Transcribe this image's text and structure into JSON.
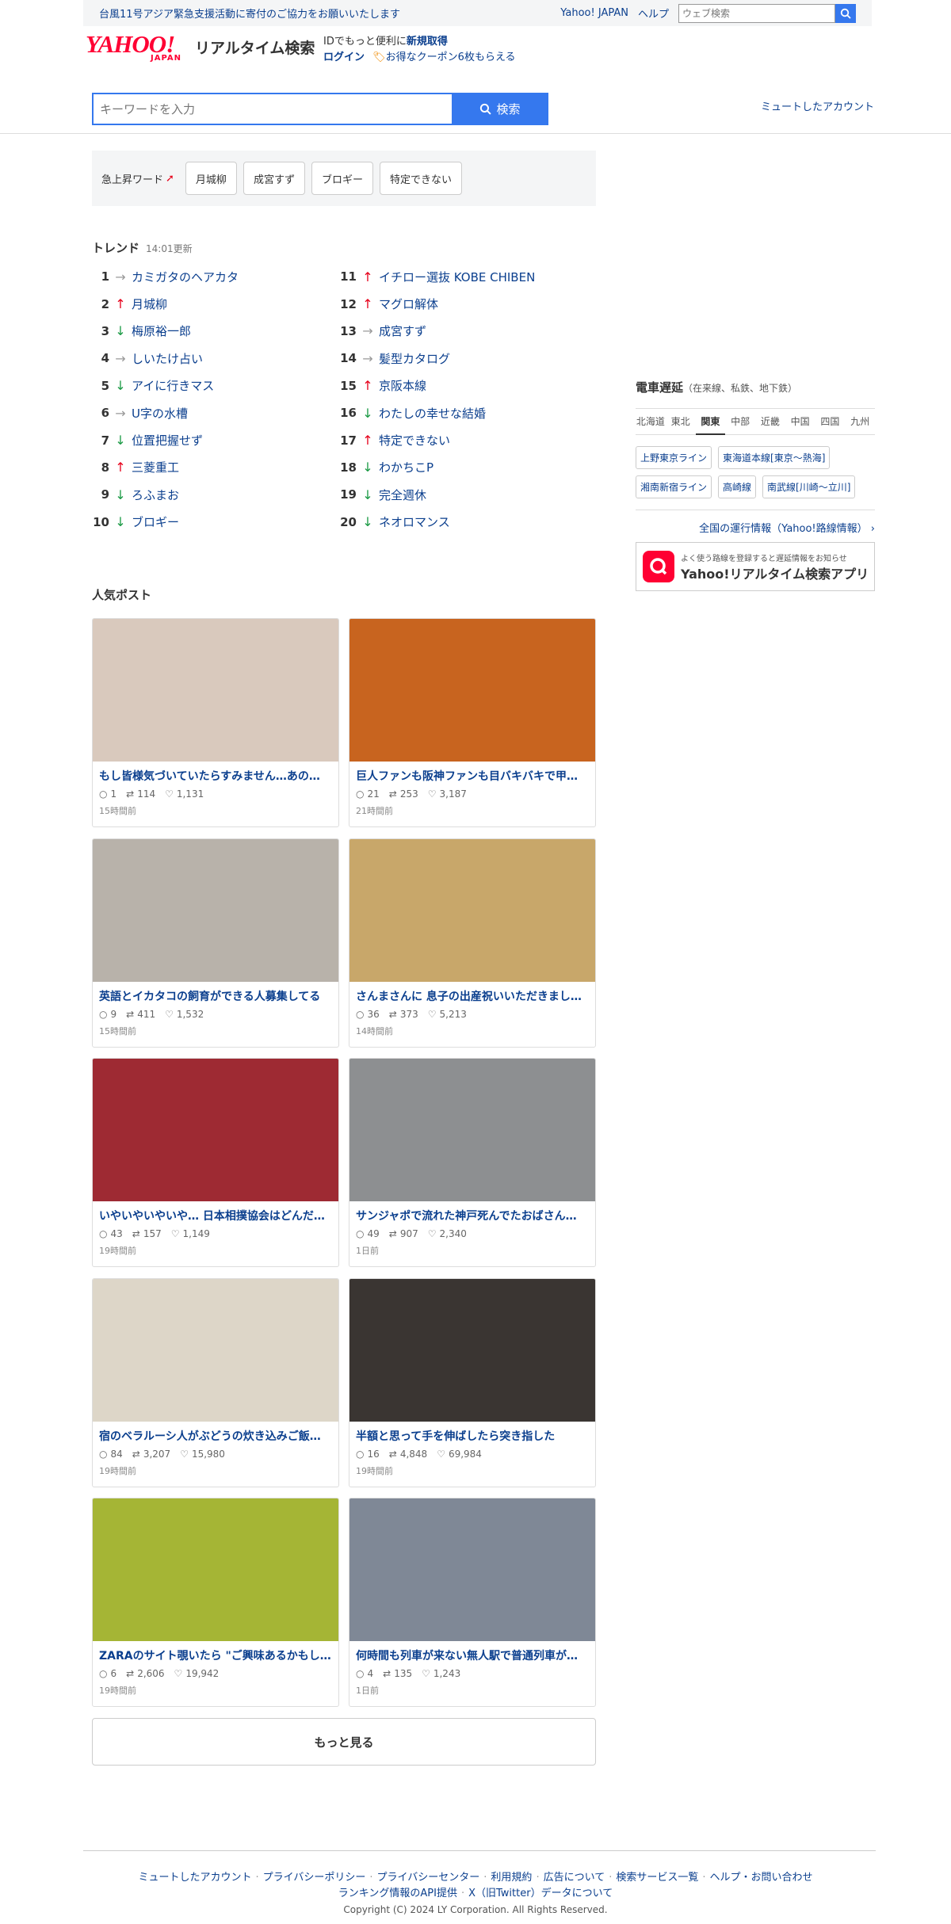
{
  "topbar": {
    "notice": "台風11号アジア緊急支援活動に寄付のご協力をお願いいたします",
    "yahoo_japan": "Yahoo! JAPAN",
    "help": "ヘルプ",
    "web_search_placeholder": "ウェブ検索"
  },
  "header": {
    "logo_yahoo": "YAHOO!",
    "logo_japan": "JAPAN",
    "logo_service": "リアルタイム検索",
    "id_text": "IDでもっと便利に",
    "id_signup": "新規取得",
    "login": "ログイン",
    "coupon": "お得なクーポン6枚もらえる"
  },
  "search": {
    "placeholder": "キーワードを入力",
    "button": "検索",
    "muted_accounts": "ミュートしたアカウント"
  },
  "rising": {
    "label": "急上昇ワード",
    "chips": [
      "月城柳",
      "成宮すず",
      "ブロギー",
      "特定できない"
    ]
  },
  "trend": {
    "title": "トレンド",
    "updated": "14:01更新",
    "items": [
      {
        "rank": "1",
        "dir": "flat",
        "word": "カミガタのヘアカタ"
      },
      {
        "rank": "2",
        "dir": "up",
        "word": "月城柳"
      },
      {
        "rank": "3",
        "dir": "down",
        "word": "梅原裕一郎"
      },
      {
        "rank": "4",
        "dir": "flat",
        "word": "しいたけ占い"
      },
      {
        "rank": "5",
        "dir": "down",
        "word": "アイに行きマス"
      },
      {
        "rank": "6",
        "dir": "flat",
        "word": "U字の水槽"
      },
      {
        "rank": "7",
        "dir": "down",
        "word": "位置把握せず"
      },
      {
        "rank": "8",
        "dir": "up",
        "word": "三菱重工"
      },
      {
        "rank": "9",
        "dir": "down",
        "word": "ろふまお"
      },
      {
        "rank": "10",
        "dir": "down",
        "word": "ブロギー"
      },
      {
        "rank": "11",
        "dir": "up",
        "word": "イチロー選抜 KOBE CHIBEN"
      },
      {
        "rank": "12",
        "dir": "up",
        "word": "マグロ解体"
      },
      {
        "rank": "13",
        "dir": "flat",
        "word": "成宮すず"
      },
      {
        "rank": "14",
        "dir": "flat",
        "word": "髪型カタログ"
      },
      {
        "rank": "15",
        "dir": "up",
        "word": "京阪本線"
      },
      {
        "rank": "16",
        "dir": "down",
        "word": "わたしの幸せな結婚"
      },
      {
        "rank": "17",
        "dir": "up",
        "word": "特定できない"
      },
      {
        "rank": "18",
        "dir": "down",
        "word": "わかちこP"
      },
      {
        "rank": "19",
        "dir": "down",
        "word": "完全週休"
      },
      {
        "rank": "20",
        "dir": "down",
        "word": "ネオロマンス"
      }
    ]
  },
  "posts": {
    "title": "人気ポスト",
    "items": [
      {
        "title": "もし皆様気づいていたらすみません…あの…",
        "replies": "1",
        "reposts": "114",
        "likes": "1,131",
        "time": "15時間前",
        "color": "#d9c9bd"
      },
      {
        "title": "巨人ファンも阪神ファンも目バキバキで甲…",
        "replies": "21",
        "reposts": "253",
        "likes": "3,187",
        "time": "21時間前",
        "color": "#c8641f"
      },
      {
        "title": "英語とイカタコの飼育ができる人募集してる",
        "replies": "9",
        "reposts": "411",
        "likes": "1,532",
        "time": "15時間前",
        "color": "#b8b2aa"
      },
      {
        "title": "さんまさんに 息子の出産祝いいただきまし…",
        "replies": "36",
        "reposts": "373",
        "likes": "5,213",
        "time": "14時間前",
        "color": "#c8a76a"
      },
      {
        "title": "いやいやいやいや… 日本相撲協会はどんだ…",
        "replies": "43",
        "reposts": "157",
        "likes": "1,149",
        "time": "19時間前",
        "color": "#9e2a33"
      },
      {
        "title": "サンジャポで流れた神戸死んでたおばさん…",
        "replies": "49",
        "reposts": "907",
        "likes": "2,340",
        "time": "1日前",
        "color": "#8d8f91"
      },
      {
        "title": "宿のベラルーシ人がぶどうの炊き込みご飯…",
        "replies": "84",
        "reposts": "3,207",
        "likes": "15,980",
        "time": "19時間前",
        "color": "#ddd6c8"
      },
      {
        "title": "半額と思って手を伸ばしたら突き指した",
        "replies": "16",
        "reposts": "4,848",
        "likes": "69,984",
        "time": "19時間前",
        "color": "#3a3532"
      },
      {
        "title": "ZARAのサイト覗いたら \"ご興味あるかもし…",
        "replies": "6",
        "reposts": "2,606",
        "likes": "19,942",
        "time": "19時間前",
        "color": "#a5b535"
      },
      {
        "title": "何時間も列車が来ない無人駅で普通列車が…",
        "replies": "4",
        "reposts": "135",
        "likes": "1,243",
        "time": "1日前",
        "color": "#7f8896"
      }
    ],
    "more": "もっと見る"
  },
  "train": {
    "title": "電車遅延",
    "subtitle": "（在来線、私鉄、地下鉄）",
    "regions": [
      "北海道",
      "東北",
      "関東",
      "中部",
      "近畿",
      "中国",
      "四国",
      "九州"
    ],
    "lines": [
      "上野東京ライン",
      "東海道本線[東京～熱海]",
      "湘南新宿ライン",
      "高崎線",
      "南武線[川崎～立川]"
    ],
    "all_info": "全国の運行情報（Yahoo!路線情報）"
  },
  "app": {
    "small": "よく使う路線を登録すると遅延情報をお知らせ",
    "name": "Yahoo!リアルタイム検索アプリ"
  },
  "footer": {
    "links1": [
      "ミュートしたアカウント",
      "プライバシーポリシー",
      "プライバシーセンター",
      "利用規約",
      "広告について",
      "検索サービス一覧",
      "ヘルプ・お問い合わせ"
    ],
    "links2": "ランキング情報のAPI提供",
    "links3": "X（旧Twitter）データについて",
    "copyright": "Copyright (C) 2024 LY Corporation. All Rights Reserved."
  },
  "colors": {
    "accent": "#3578ee",
    "link": "#0b3f8e",
    "brand": "#ff0033",
    "up": "#e6001a",
    "down": "#1a9944"
  }
}
